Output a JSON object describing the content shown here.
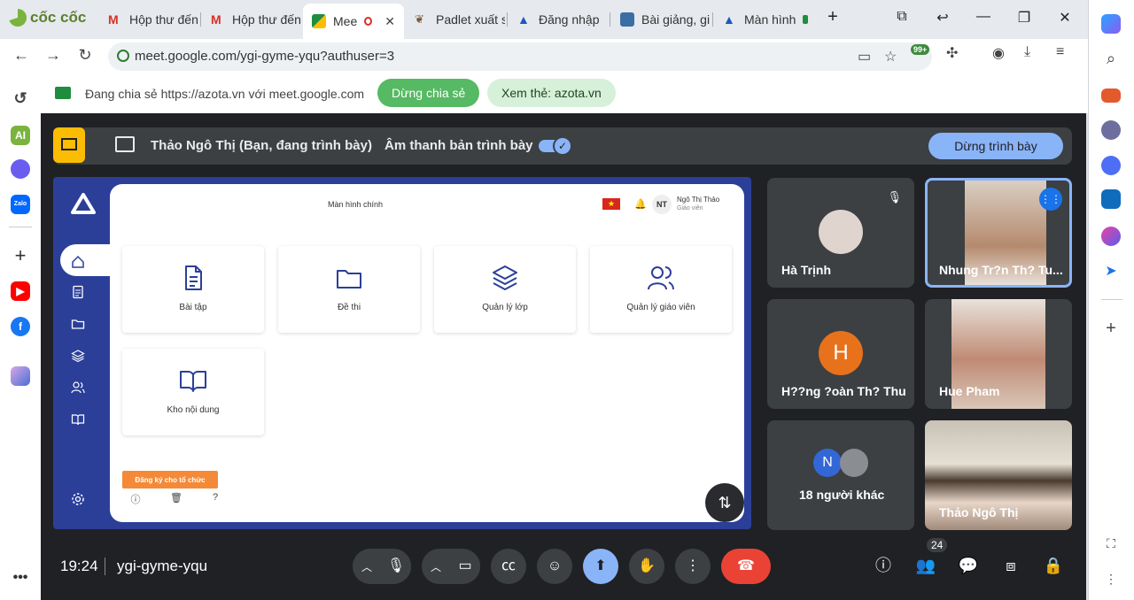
{
  "browser": {
    "brand": "cốc cốc",
    "tabs": [
      {
        "label": "Hộp thư đến",
        "color": "#d93025"
      },
      {
        "label": "Hộp thư đến",
        "color": "#d93025"
      },
      {
        "label": "Mee",
        "color": "#1e8e3e"
      },
      {
        "label": "Padlet xuất s",
        "color": "#7a5a3a"
      },
      {
        "label": "Đăng nhập",
        "color": "#1a56c4"
      },
      {
        "label": "Bài giảng, gi",
        "color": "#3a6ea5"
      },
      {
        "label": "Màn hình",
        "color": "#1a56c4"
      }
    ],
    "url": "meet.google.com/ygi-gyme-yqu?authuser=3",
    "extension_badge": "99+"
  },
  "sharebar": {
    "text": "Đang chia sẻ https://azota.vn với meet.google.com",
    "stop_label": "Dừng chia sẻ",
    "view_label": "Xem thẻ: azota.vn"
  },
  "left_sidebar": {
    "ai_label": "AI",
    "zalo_label": "Zalo"
  },
  "presenting": {
    "name": "Thảo Ngô Thị (Bạn, đang trình bày)",
    "audio_label": "Âm thanh bản trình bày",
    "stop_label": "Dừng trình bày"
  },
  "screen": {
    "title": "Màn hình chính",
    "user_initials": "NT",
    "user_name": "Ngô Thị Thảo",
    "user_role": "Giáo viên",
    "cards": [
      "Bài tập",
      "Đề thi",
      "Quản lý lớp",
      "Quản lý giáo viên",
      "Kho nội dung"
    ],
    "register_label": "Đăng ký cho tổ chức"
  },
  "participants": [
    {
      "name": "Hà Trịnh"
    },
    {
      "name": "Nhung Tr?n Th? Tu..."
    },
    {
      "name": "H??ng ?oàn Th? Thu",
      "initial": "H"
    },
    {
      "name": "Hue Pham"
    },
    {
      "name": "18 người khác",
      "initial": "N"
    },
    {
      "name": "Thảo Ngô Thị"
    }
  ],
  "meeting": {
    "time": "19:24",
    "code": "ygi-gyme-yqu",
    "people_count": "24"
  },
  "colors": {
    "end_call": "#ea4335",
    "accent": "#8ab4f8",
    "present": "#fbbc04"
  }
}
